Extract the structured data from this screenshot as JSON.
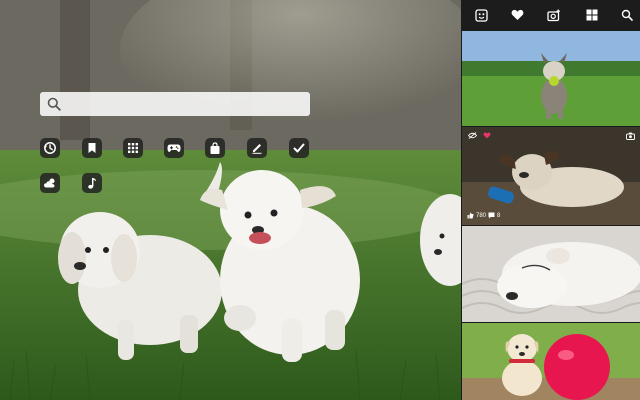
{
  "search": {
    "value": "",
    "placeholder": ""
  },
  "shortcuts": [
    {
      "icon": "history-icon"
    },
    {
      "icon": "bookmark-icon"
    },
    {
      "icon": "apps-grid-icon"
    },
    {
      "icon": "gamepad-icon"
    },
    {
      "icon": "shopping-bag-icon"
    },
    {
      "icon": "edit-icon"
    },
    {
      "icon": "checkmark-icon"
    },
    {
      "icon": "weather-icon"
    },
    {
      "icon": "music-note-icon"
    }
  ],
  "panel": {
    "toolbar": [
      "dog-face-icon",
      "heart-icon",
      "add-photo-icon",
      "grid-icon",
      "search-icon"
    ],
    "thumbnails": [
      {
        "subject": "puppy-with-ball"
      },
      {
        "subject": "puppy-lying-with-toy",
        "likes": "780",
        "comments": "8"
      },
      {
        "subject": "sleeping-puppy"
      },
      {
        "subject": "puppy-with-balloon"
      }
    ]
  },
  "colors": {
    "panel_bg": "#1a1a1a",
    "accent_heart": "#e8336d",
    "search_bg": "#f2f2f2",
    "shortcut_bg": "#222222"
  }
}
